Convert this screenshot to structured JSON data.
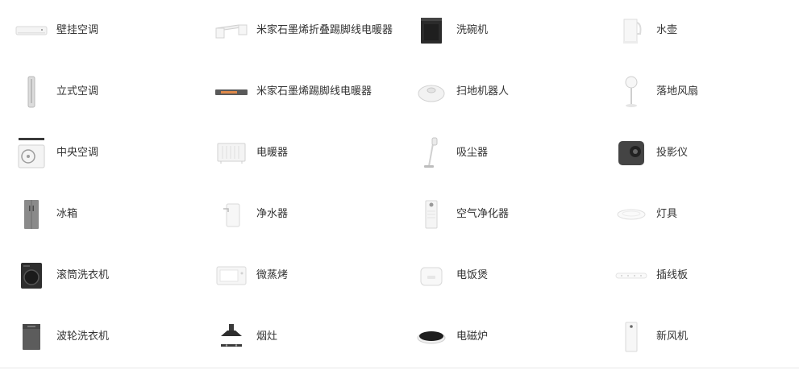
{
  "items": [
    {
      "label": "壁挂空调",
      "icon": "wall-ac-icon"
    },
    {
      "label": "米家石墨烯折叠踢脚线电暖器",
      "icon": "folding-baseboard-heater-icon"
    },
    {
      "label": "洗碗机",
      "icon": "dishwasher-icon"
    },
    {
      "label": "水壶",
      "icon": "kettle-icon"
    },
    {
      "label": "立式空调",
      "icon": "standing-ac-icon"
    },
    {
      "label": "米家石墨烯踢脚线电暖器",
      "icon": "baseboard-heater-icon"
    },
    {
      "label": "扫地机器人",
      "icon": "robot-vacuum-icon"
    },
    {
      "label": "落地风扇",
      "icon": "floor-fan-icon"
    },
    {
      "label": "中央空调",
      "icon": "central-ac-icon"
    },
    {
      "label": "电暖器",
      "icon": "heater-icon"
    },
    {
      "label": "吸尘器",
      "icon": "vacuum-cleaner-icon"
    },
    {
      "label": "投影仪",
      "icon": "projector-icon"
    },
    {
      "label": "冰箱",
      "icon": "refrigerator-icon"
    },
    {
      "label": "净水器",
      "icon": "water-purifier-icon"
    },
    {
      "label": "空气净化器",
      "icon": "air-purifier-icon"
    },
    {
      "label": "灯具",
      "icon": "ceiling-light-icon"
    },
    {
      "label": "滚筒洗衣机",
      "icon": "front-load-washer-icon"
    },
    {
      "label": "微蒸烤",
      "icon": "steam-oven-icon"
    },
    {
      "label": "电饭煲",
      "icon": "rice-cooker-icon"
    },
    {
      "label": "插线板",
      "icon": "power-strip-icon"
    },
    {
      "label": "波轮洗衣机",
      "icon": "top-load-washer-icon"
    },
    {
      "label": "烟灶",
      "icon": "range-hood-stove-icon"
    },
    {
      "label": "电磁炉",
      "icon": "induction-cooker-icon"
    },
    {
      "label": "新风机",
      "icon": "fresh-air-system-icon"
    }
  ]
}
